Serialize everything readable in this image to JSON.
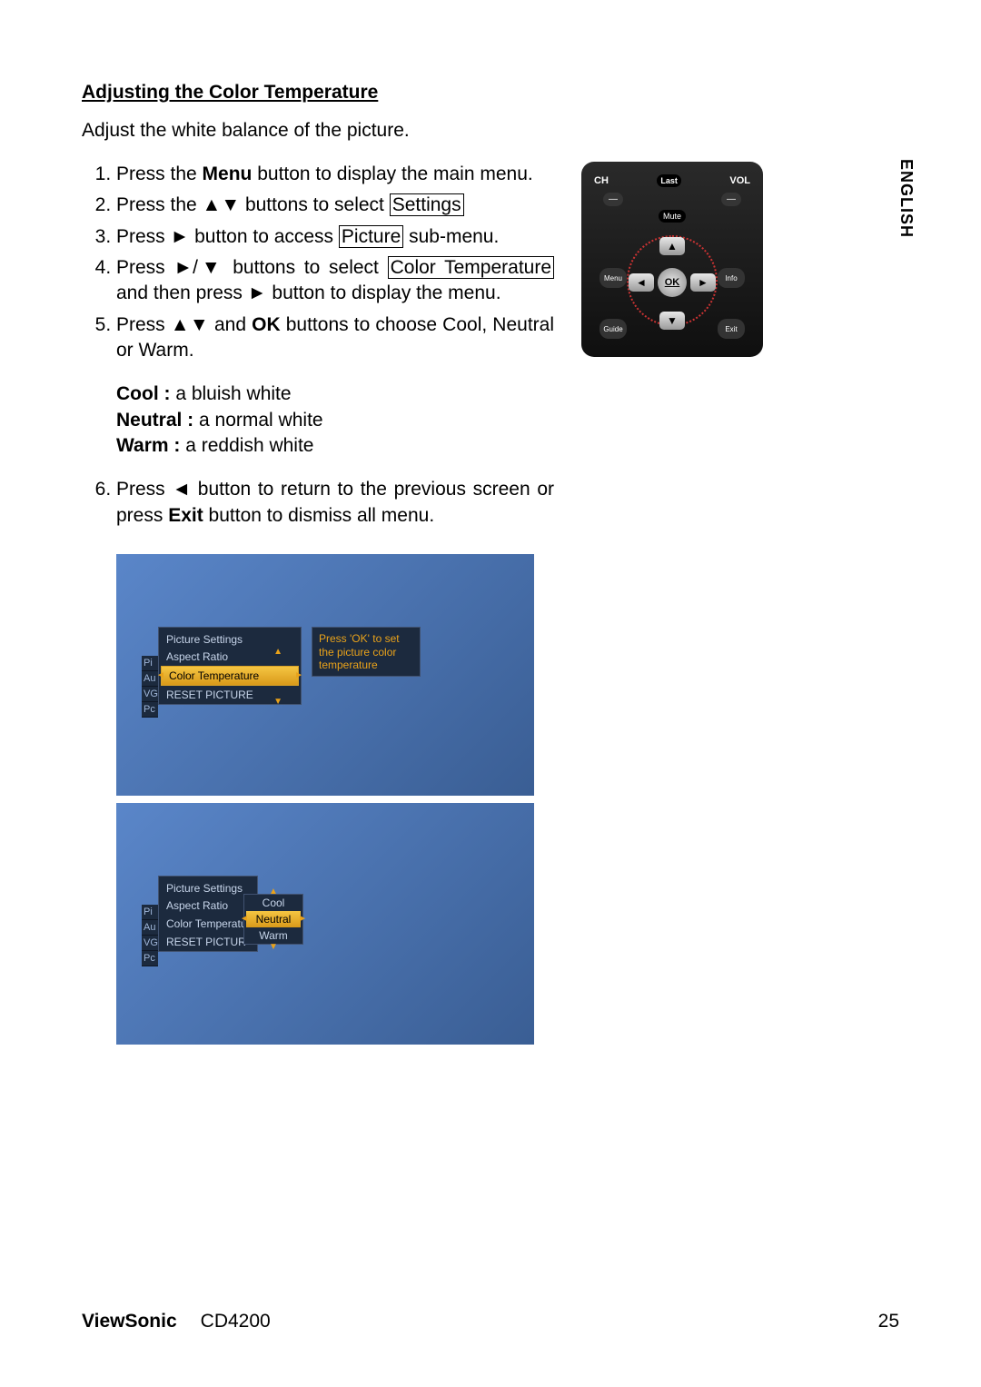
{
  "lang_tab": "ENGLISH",
  "section_title": "Adjusting the Color Temperature",
  "intro": "Adjust the white balance of the picture.",
  "steps": {
    "s1_a": "Press the ",
    "s1_b": "Menu",
    "s1_c": " button to display the main menu.",
    "s2_a": "Press the ▲▼ buttons to select ",
    "s2_box": "Settings",
    "s3_a": "Press ► button to access ",
    "s3_box": "Picture",
    "s3_c": " sub-menu.",
    "s4_a": "Press ►/▼ buttons to select ",
    "s4_box": "Color Temperature",
    "s4_c": " and then press ► button to display the menu.",
    "s5_a": "Press ▲▼ and ",
    "s5_b": "OK",
    "s5_c": " buttons to choose Cool, Neutral or Warm.",
    "desc_cool_label": "Cool : ",
    "desc_cool_text": "a bluish white",
    "desc_neutral_label": "Neutral : ",
    "desc_neutral_text": "a normal white",
    "desc_warm_label": "Warm : ",
    "desc_warm_text": "a reddish white",
    "s6_a": "Press ◄ button to return to the previous screen or press ",
    "s6_b": "Exit",
    "s6_c": " button to dismiss all menu."
  },
  "remote": {
    "ch": "CH",
    "vol": "VOL",
    "last": "Last",
    "minus": "—",
    "plus": "—",
    "mute": "Mute",
    "menu": "Menu",
    "info": "Info",
    "guide": "Guide",
    "exit": "Exit",
    "up": "▲",
    "down": "▼",
    "left": "◄",
    "right": "►",
    "ok": "OK"
  },
  "screen1": {
    "sidebar": [
      "Pi",
      "Au",
      "VG",
      "Pc"
    ],
    "panel_header": "Picture Settings",
    "items": [
      "Aspect Ratio",
      "Color Temperature",
      "RESET PICTURE"
    ],
    "selected_index": 1,
    "tooltip": "Press 'OK' to set the picture color temperature"
  },
  "screen2": {
    "sidebar": [
      "Pi",
      "Au",
      "VG",
      "Pc"
    ],
    "panel_header": "Picture Settings",
    "items": [
      "Aspect Ratio",
      "Color Temperatu",
      "RESET PICTUR"
    ],
    "popup": {
      "options": [
        "Cool",
        "Neutral",
        "Warm"
      ],
      "selected_index": 1
    }
  },
  "footer": {
    "brand": "ViewSonic",
    "model": "CD4200",
    "page": "25"
  }
}
